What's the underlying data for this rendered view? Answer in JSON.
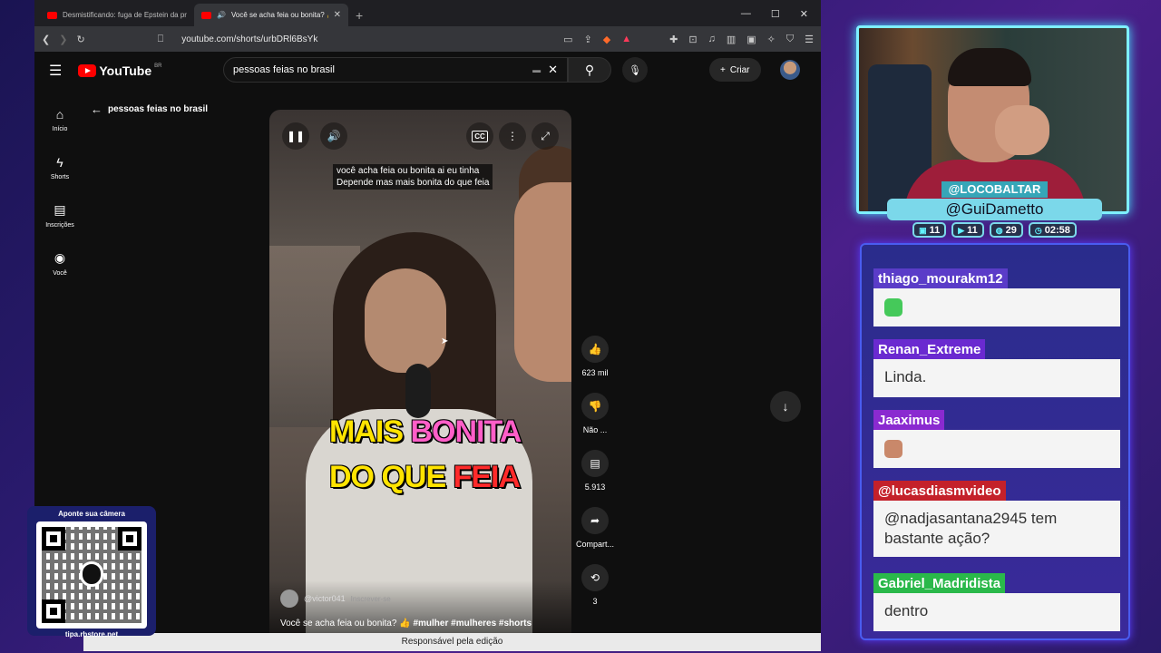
{
  "browser": {
    "tabs": [
      {
        "title": "Desmistificando: fuga de Epstein da prisão e",
        "active": false
      },
      {
        "title": "Você se acha feia ou bonita? 👍 #m",
        "active": true
      }
    ],
    "url": "youtube.com/shorts/urbDRl6BsYk"
  },
  "youtube": {
    "logo_text": "YouTube",
    "region": "BR",
    "search_value": "pessoas feias no brasil",
    "create_label": "Criar",
    "sidebar": [
      {
        "label": "Início",
        "icon": "home-icon"
      },
      {
        "label": "Shorts",
        "icon": "shorts-icon"
      },
      {
        "label": "Inscrições",
        "icon": "subscriptions-icon"
      },
      {
        "label": "Você",
        "icon": "you-icon"
      }
    ],
    "back_label": "pessoas feias no brasil"
  },
  "video": {
    "subtitle_line1": "você acha feia ou bonita ai eu tinha",
    "subtitle_line2": "Depende mas mais bonita do que feia",
    "overlay_l1a": "MAIS ",
    "overlay_l1b": "BONITA",
    "overlay_l2a": "DO QUE ",
    "overlay_l2b": "FEIA",
    "channel": "@victor041",
    "subscribe": "Inscrever-se",
    "title": "Você se acha feia ou bonita? 👍",
    "hashtags": "#mulher #mulheres #shorts",
    "likes": "623 mil",
    "dislike": "Não ...",
    "comments": "5.913",
    "share": "Compart...",
    "remix": "3"
  },
  "banner": "Responsável pela edição",
  "qr": {
    "top_text": "Aponte sua câmera",
    "bottom_text": "tipa.rbstore.net"
  },
  "stream": {
    "handle": "@LOCOBALTAR",
    "name": "@GuiDametto",
    "stats": [
      {
        "icon": "twitch-icon",
        "value": "11"
      },
      {
        "icon": "youtube-icon",
        "value": "11"
      },
      {
        "icon": "kick-icon",
        "value": "29"
      },
      {
        "icon": "clock-icon",
        "value": "02:58"
      }
    ]
  },
  "chat": [
    {
      "user": "thiago_mourakm12",
      "color": "#5a3cc8",
      "text": "",
      "emote": "#45c95a"
    },
    {
      "user": "Renan_Extreme",
      "color": "#6a2ad0",
      "text": "Linda.",
      "emote": null
    },
    {
      "user": "Jaaximus",
      "color": "#8a2ad0",
      "text": "",
      "emote": "#c9886a"
    },
    {
      "user": "@lucasdiasmvideo",
      "color": "#c4212a",
      "text": "@nadjasantana2945 tem bastante ação?",
      "emote": null
    },
    {
      "user": "Gabriel_Madridista",
      "color": "#2ab84a",
      "text": "dentro",
      "emote": null
    }
  ]
}
